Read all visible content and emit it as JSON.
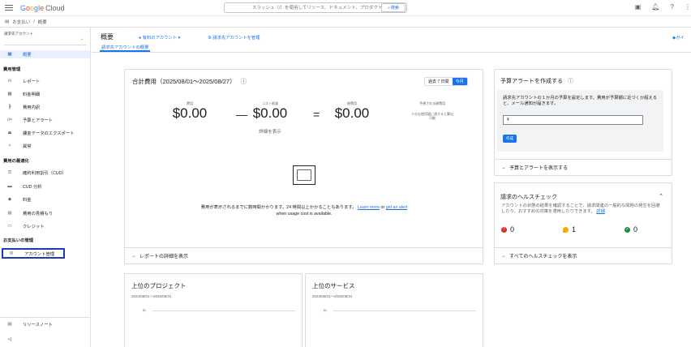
{
  "app": {
    "brand_google": "Google",
    "brand_cloud": "Cloud"
  },
  "search": {
    "placeholder": "スラッシュ（/）を使用してリソース、ドキュメント、プロダクトなどを検索",
    "button_label": "検索"
  },
  "breadcrumb": {
    "items": [
      "お支払い",
      "概要"
    ],
    "sep": "/"
  },
  "sidebar": {
    "account_label": "請求先アカウント",
    "overview": "概要",
    "section_cost_mgmt": "費用管理",
    "items_cost": [
      "レポート",
      "料金明細",
      "費用内訳",
      "予算とアラート",
      "課金データのエクスポート",
      "異常"
    ],
    "section_optimization": "費用の最適化",
    "items_opt": [
      "確約利用割引（CUD）",
      "CUD 分析",
      "料金",
      "費用の見積もり",
      "クレジット"
    ],
    "section_payment": "お支払いの管理",
    "account_mgmt": "アカウント管理",
    "release_notes": "リリースノート",
    "collapse": "<|"
  },
  "header": {
    "title": "概要",
    "account_link": "有料のアカウント",
    "manage_link": "請求先アカウントを管理",
    "guide": "ガイ",
    "tab": "請求先アカウントの概要"
  },
  "total_cost": {
    "title": "合計費用（2025/08/01〜2025/08/27）",
    "range_buttons": [
      "過去 7 日間",
      "今月"
    ],
    "cost_label": "費用",
    "cost_value": "$0.00",
    "minus": "—",
    "savings_label": "コスト削減",
    "savings_value": "$0.00",
    "savings_detail": "詳細を表示",
    "equals": "=",
    "total_label": "総費用",
    "total_value": "$0.00",
    "forecast_label": "予想される総費用",
    "forecast_note": "十分な使用量に達すると算出可能",
    "empty_msg_1": "費用が表示されるまでに数時間かかります。24 時間以上かかることもあります。",
    "learn_more": "Learn more",
    "or": " or ",
    "get_alert": "get an alert",
    "empty_msg_2": " when usage cost is available.",
    "footer_link": "レポートの詳細を表示"
  },
  "budget": {
    "title": "予算アラートを作成する",
    "desc": "請求先アカウントの１か月の予算を設定します。費用が予算額に近づくか超えると、メール通知が届きます。",
    "input_prefix": "¥",
    "create_button": "作成",
    "footer_link": "予算とアラートを表示する"
  },
  "health": {
    "title": "請求のヘルスチェック",
    "desc": "アカウントの状態の結果を確認することで、請求関連の一般的な問題の発生を回避したり、おすすめの対策を適用したりできます。",
    "detail_link": "詳細",
    "counts": [
      "0",
      "1",
      "0"
    ],
    "footer_link": "すべてのヘルスチェックを表示"
  },
  "top_projects": {
    "title": "上位のプロジェクト",
    "date": "2024/08/01〜2025/08/31",
    "tick": "$1"
  },
  "top_services": {
    "title": "上位のサービス",
    "date": "2024/08/01〜2025/08/31",
    "tick": "$1"
  },
  "colors": {
    "accent": "#1a73e8",
    "error": "#d93025",
    "warning": "#f9ab00",
    "success": "#1e8e3e"
  }
}
